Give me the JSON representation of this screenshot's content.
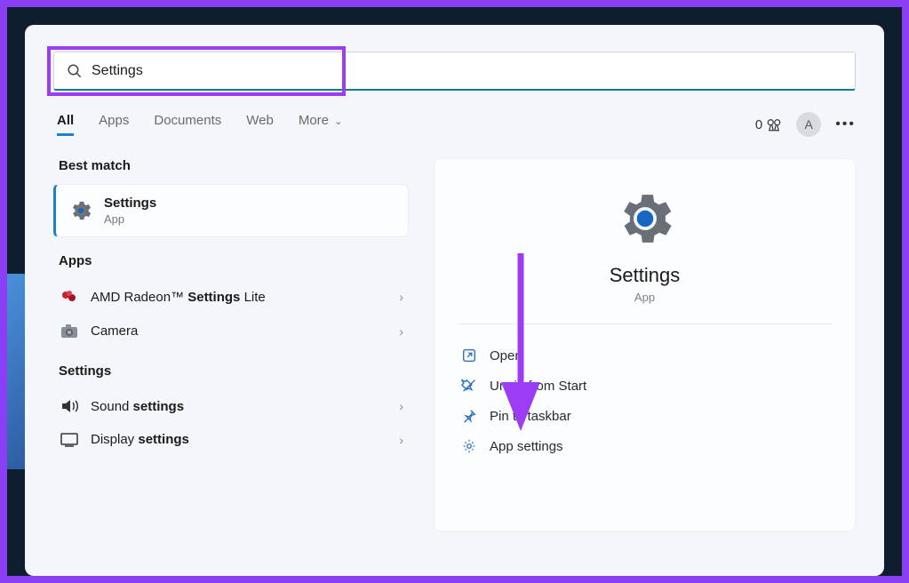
{
  "search": {
    "query": "Settings"
  },
  "tabs": [
    "All",
    "Apps",
    "Documents",
    "Web",
    "More"
  ],
  "active_tab": "All",
  "rewards_count": "0",
  "avatar_initial": "A",
  "left": {
    "best_match_label": "Best match",
    "best": {
      "title": "Settings",
      "subtitle": "App"
    },
    "apps_label": "Apps",
    "apps": [
      {
        "prefix": "AMD Radeon™ ",
        "bold": "Settings",
        "suffix": " Lite",
        "icon": "amd"
      },
      {
        "prefix": "",
        "bold": "",
        "suffix": "Camera",
        "icon": "camera"
      }
    ],
    "settings_label": "Settings",
    "settings": [
      {
        "prefix": "Sound ",
        "bold": "settings",
        "icon": "sound"
      },
      {
        "prefix": "Display ",
        "bold": "settings",
        "icon": "display"
      }
    ]
  },
  "detail": {
    "title": "Settings",
    "subtitle": "App",
    "actions": [
      "Open",
      "Unpin from Start",
      "Pin to taskbar",
      "App settings"
    ]
  }
}
